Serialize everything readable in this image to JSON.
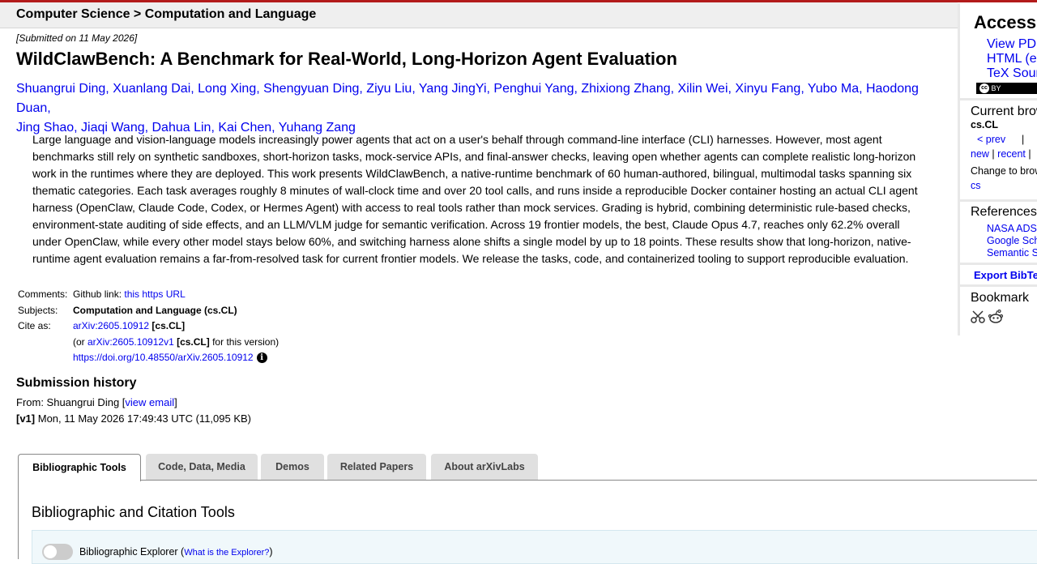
{
  "header": {
    "breadcrumb": "Computer Science > Computation and Language"
  },
  "paper": {
    "submitted": "[Submitted on 11 May 2026]",
    "title": "WildClawBench: A Benchmark for Real-World, Long-Horizon Agent Evaluation",
    "authors_line1": "Shuangrui Ding, Xuanlang Dai, Long Xing, Shengyuan Ding, Ziyu Liu, Yang JingYi, Penghui Yang, Zhixiong Zhang, Xilin Wei, Xinyu Fang, Yubo Ma, Haodong Duan,",
    "authors_line2": "Jing Shao, Jiaqi Wang, Dahua Lin, Kai Chen, Yuhang Zang",
    "abstract": "Large language and vision-language models increasingly power agents that act on a user's behalf through command-line interface (CLI) harnesses. However, most agent benchmarks still rely on synthetic sandboxes, short-horizon tasks, mock-service APIs, and final-answer checks, leaving open whether agents can complete realistic long-horizon work in the runtimes where they are deployed. This work presents WildClawBench, a native-runtime benchmark of 60 human-authored, bilingual, multimodal tasks spanning six thematic categories. Each task averages roughly 8 minutes of wall-clock time and over 20 tool calls, and runs inside a reproducible Docker container hosting an actual CLI agent harness (OpenClaw, Claude Code, Codex, or Hermes Agent) with access to real tools rather than mock services. Grading is hybrid, combining deterministic rule-based checks, environment-state auditing of side effects, and an LLM/VLM judge for semantic verification. Across 19 frontier models, the best, Claude Opus 4.7, reaches only 62.2% overall under OpenClaw, while every other model stays below 60%, and switching harness alone shifts a single model by up to 18 points. These results show that long-horizon, native-runtime agent evaluation remains a far-from-resolved task for current frontier models. We release the tasks, code, and containerized tooling to support reproducible evaluation."
  },
  "meta": {
    "comments_label": "Comments:",
    "comments_text": "Github link: ",
    "comments_link": "this https URL",
    "subjects_label": "Subjects:",
    "subjects_value": "Computation and Language (cs.CL)",
    "cite_label": "Cite as:",
    "cite_id": "arXiv:2605.10912",
    "cite_cat": " [cs.CL]",
    "cite_or": "(or ",
    "cite_v1": "arXiv:2605.10912v1",
    "cite_v1_cat": " [cs.CL]",
    "cite_v1_suffix": " for this version)",
    "doi": "https://doi.org/10.48550/arXiv.2605.10912"
  },
  "history": {
    "title": "Submission history",
    "from_prefix": "From: Shuangrui Ding [",
    "view_email": "view email",
    "from_suffix": "]",
    "v1_tag": "[v1]",
    "v1_text": " Mon, 11 May 2026 17:49:43 UTC (11,095 KB)"
  },
  "tabs": [
    {
      "label": "Bibliographic Tools"
    },
    {
      "label": "Code, Data, Media"
    },
    {
      "label": "Demos"
    },
    {
      "label": "Related Papers"
    },
    {
      "label": "About arXivLabs"
    }
  ],
  "panel": {
    "title": "Bibliographic and Citation Tools",
    "explorer_label": "Bibliographic Explorer (",
    "explorer_link": "What is the Explorer?",
    "explorer_suffix": ")"
  },
  "sidebar": {
    "access_title": "Access",
    "view_pdf": "View PDF",
    "html": "HTML (experimental)",
    "tex": "TeX Source",
    "cc_label": "BY",
    "current_browse": "Current browse context:",
    "context": "cs.CL",
    "prev": "< prev",
    "sep": "|",
    "new": "new",
    "recent": "recent",
    "change_browse": "Change to browse by:",
    "cs": "cs",
    "references_title": "References & Citations",
    "nasa": "NASA ADS",
    "google": "Google Scholar",
    "semantic": "Semantic Scholar",
    "export_bibtex": "Export BibTeX Citation",
    "bookmark": "Bookmark"
  },
  "colors": {
    "accent": "#b31b1b",
    "link": "#0000ee"
  }
}
